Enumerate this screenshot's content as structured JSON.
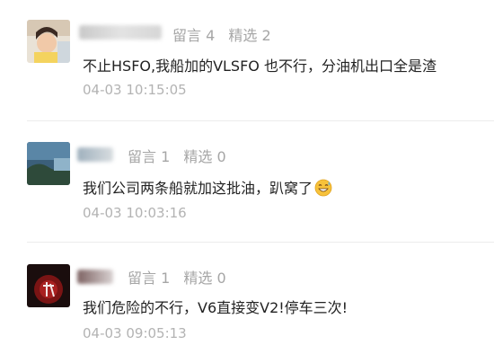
{
  "comments": [
    {
      "reply_count": "留言 4",
      "featured_count": "精选 2",
      "text": "不止HSFO,我船加的VLSFO 也不行，分油机出口全是渣",
      "time": "04-03 10:15:05"
    },
    {
      "reply_count": "留言 1",
      "featured_count": "精选 0",
      "text": "我们公司两条船就加这批油，趴窝了",
      "emoji": "grinning-sweat-emoji",
      "time": "04-03 10:03:16"
    },
    {
      "reply_count": "留言 1",
      "featured_count": "精选 0",
      "text": "我们危险的不行，V6直接变V2!停车三次!",
      "time": "04-03 09:05:13"
    }
  ]
}
